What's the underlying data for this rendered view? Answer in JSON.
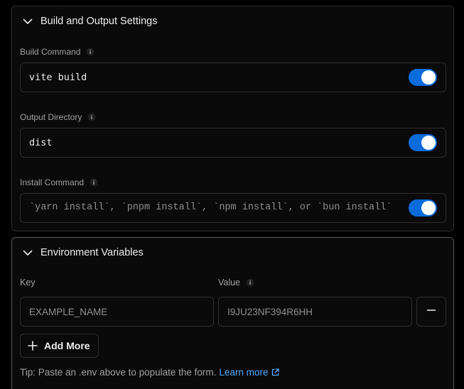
{
  "build_section": {
    "title": "Build and Output Settings",
    "fields": [
      {
        "label": "Build Command",
        "value": "vite build",
        "override_enabled": true
      },
      {
        "label": "Output Directory",
        "value": "dist",
        "override_enabled": true
      },
      {
        "label": "Install Command",
        "placeholder": "`yarn install`, `pnpm install`, `npm install`, or `bun install`",
        "override_enabled": true
      }
    ]
  },
  "env_section": {
    "title": "Environment Variables",
    "key_label": "Key",
    "value_label": "Value",
    "key_placeholder": "EXAMPLE_NAME",
    "value_placeholder": "I9JU23NF394R6HH",
    "add_more_label": "Add More",
    "tip_text": "Tip: Paste an .env above to populate the form.",
    "learn_more_label": "Learn more"
  },
  "colors": {
    "background": "#000000",
    "toggle_on": "#0a6cdb",
    "link": "#52a8ff"
  },
  "icons": {
    "chevron": "chevron-down-icon",
    "info": "info-icon",
    "minus": "minus-icon",
    "plus": "plus-icon",
    "external": "external-link-icon"
  }
}
